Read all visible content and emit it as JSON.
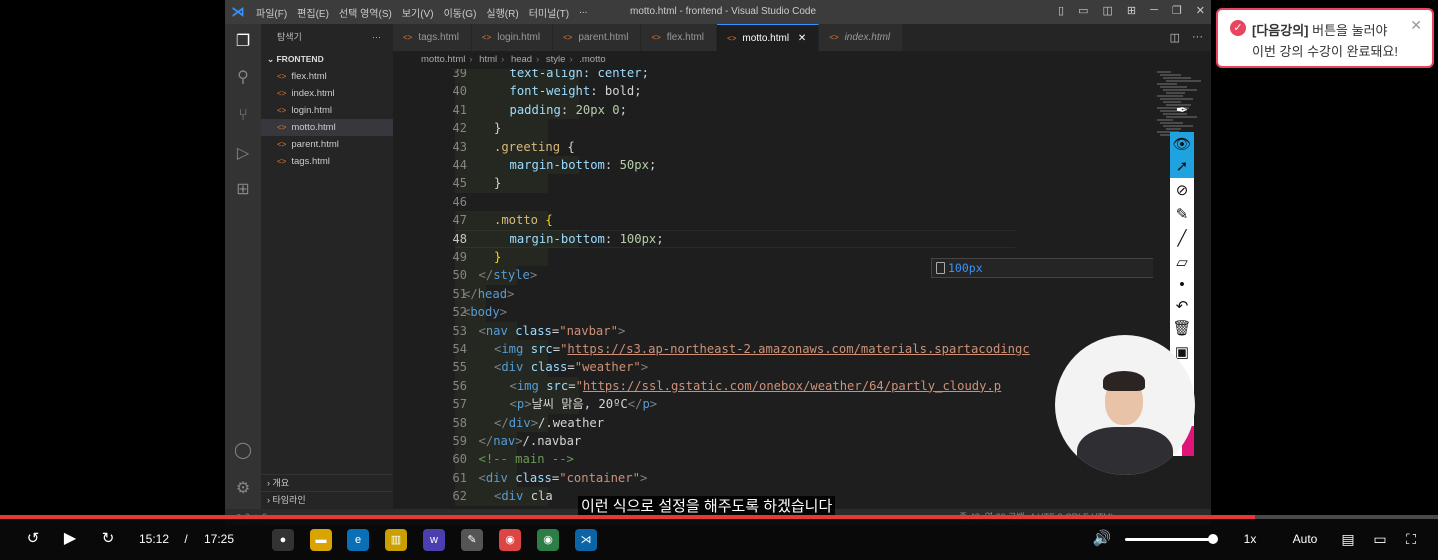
{
  "vscode": {
    "menu": [
      "파일(F)",
      "편집(E)",
      "선택 영역(S)",
      "보기(V)",
      "이동(G)",
      "실행(R)",
      "터미널(T)",
      "..."
    ],
    "window_title": "motto.html - frontend - Visual Studio Code",
    "explorer_title": "탐색기",
    "project": "FRONTEND",
    "files": [
      "flex.html",
      "index.html",
      "login.html",
      "motto.html",
      "parent.html",
      "tags.html"
    ],
    "selected_file": "motto.html",
    "outline_label": "개요",
    "timeline_label": "타임라인",
    "tabs": [
      {
        "label": "tags.html"
      },
      {
        "label": "login.html"
      },
      {
        "label": "parent.html"
      },
      {
        "label": "flex.html"
      },
      {
        "label": "motto.html",
        "active": true
      },
      {
        "label": "index.html",
        "italic": true
      }
    ],
    "breadcrumbs": [
      "motto.html",
      "html",
      "head",
      "style",
      ".motto"
    ],
    "suggestion": "100px",
    "status_left": "⊗ 0 △ 0",
    "status_right": "줄 48, 열 23   공백: 4   UTF-8   CRLF   HTML"
  },
  "code_lines": [
    {
      "n": "39",
      "indent": 4,
      "parts": [
        [
          "k-prop",
          "text-align: center;"
        ]
      ]
    },
    {
      "n": "40",
      "indent": 4,
      "parts": [
        [
          "k-prop",
          "font-weight"
        ],
        [
          "",
          ": "
        ],
        [
          "",
          "bold"
        ],
        [
          "",
          ";"
        ]
      ]
    },
    {
      "n": "41",
      "indent": 4,
      "parts": [
        [
          "k-prop",
          "padding"
        ],
        [
          "",
          ": "
        ],
        [
          "k-num",
          "20px 0"
        ],
        [
          "",
          ";"
        ]
      ]
    },
    {
      "n": "42",
      "indent": 3,
      "parts": [
        [
          "",
          "}"
        ]
      ]
    },
    {
      "n": "43",
      "indent": 3,
      "parts": [
        [
          "k-sel",
          ".greeting"
        ],
        [
          "",
          " {"
        ]
      ]
    },
    {
      "n": "44",
      "indent": 4,
      "parts": [
        [
          "k-prop",
          "margin-bottom"
        ],
        [
          "",
          ": "
        ],
        [
          "k-num",
          "50px"
        ],
        [
          "",
          ";"
        ]
      ]
    },
    {
      "n": "45",
      "indent": 3,
      "parts": [
        [
          "",
          "}"
        ]
      ]
    },
    {
      "n": "46",
      "indent": 0,
      "parts": []
    },
    {
      "n": "47",
      "indent": 3,
      "parts": [
        [
          "k-sel",
          ".motto"
        ],
        [
          "",
          " "
        ],
        [
          "k-bracket",
          "{"
        ]
      ]
    },
    {
      "n": "48",
      "indent": 4,
      "parts": [
        [
          "k-prop",
          "margin-bottom"
        ],
        [
          "",
          ": "
        ],
        [
          "k-num",
          "100px"
        ],
        [
          "",
          ";"
        ]
      ],
      "current": true
    },
    {
      "n": "49",
      "indent": 3,
      "parts": [
        [
          "k-bracket",
          "}"
        ]
      ]
    },
    {
      "n": "50",
      "indent": 2,
      "parts": [
        [
          "k-br",
          "</"
        ],
        [
          "k-tag",
          "style"
        ],
        [
          "k-br",
          ">"
        ]
      ]
    },
    {
      "n": "51",
      "indent": 1,
      "parts": [
        [
          "k-br",
          "</"
        ],
        [
          "k-tag",
          "head"
        ],
        [
          "k-br",
          ">"
        ]
      ]
    },
    {
      "n": "52",
      "indent": 1,
      "parts": [
        [
          "k-br",
          "<"
        ],
        [
          "k-tag",
          "body"
        ],
        [
          "k-br",
          ">"
        ]
      ]
    },
    {
      "n": "53",
      "indent": 2,
      "parts": [
        [
          "k-br",
          "<"
        ],
        [
          "k-tag",
          "nav"
        ],
        [
          "",
          " "
        ],
        [
          "k-attr",
          "class"
        ],
        [
          "",
          "="
        ],
        [
          "k-str",
          "\"navbar\""
        ],
        [
          "k-br",
          ">"
        ]
      ]
    },
    {
      "n": "54",
      "indent": 3,
      "parts": [
        [
          "k-br",
          "<"
        ],
        [
          "k-tag",
          "img"
        ],
        [
          "",
          " "
        ],
        [
          "k-attr",
          "src"
        ],
        [
          "",
          "="
        ],
        [
          "k-str",
          "\""
        ],
        [
          "k-url",
          "https://s3.ap-northeast-2.amazonaws.com/materials.spartacodingc"
        ]
      ]
    },
    {
      "n": "55",
      "indent": 3,
      "parts": [
        [
          "k-br",
          "<"
        ],
        [
          "k-tag",
          "div"
        ],
        [
          "",
          " "
        ],
        [
          "k-attr",
          "class"
        ],
        [
          "",
          "="
        ],
        [
          "k-str",
          "\"weather\""
        ],
        [
          "k-br",
          ">"
        ]
      ]
    },
    {
      "n": "56",
      "indent": 4,
      "parts": [
        [
          "k-br",
          "<"
        ],
        [
          "k-tag",
          "img"
        ],
        [
          "",
          " "
        ],
        [
          "k-attr",
          "src"
        ],
        [
          "",
          "="
        ],
        [
          "k-str",
          "\""
        ],
        [
          "k-url",
          "https://ssl.gstatic.com/onebox/weather/64/partly_cloudy.p"
        ]
      ]
    },
    {
      "n": "57",
      "indent": 4,
      "parts": [
        [
          "k-br",
          "<"
        ],
        [
          "k-tag",
          "p"
        ],
        [
          "k-br",
          ">"
        ],
        [
          "",
          "날씨 맑음, 20ºC"
        ],
        [
          "k-br",
          "</"
        ],
        [
          "k-tag",
          "p"
        ],
        [
          "k-br",
          ">"
        ]
      ]
    },
    {
      "n": "58",
      "indent": 3,
      "parts": [
        [
          "k-br",
          "</"
        ],
        [
          "k-tag",
          "div"
        ],
        [
          "k-br",
          ">"
        ],
        [
          "",
          "/.weather"
        ]
      ]
    },
    {
      "n": "59",
      "indent": 2,
      "parts": [
        [
          "k-br",
          "</"
        ],
        [
          "k-tag",
          "nav"
        ],
        [
          "k-br",
          ">"
        ],
        [
          "",
          "/.navbar"
        ]
      ]
    },
    {
      "n": "60",
      "indent": 2,
      "parts": [
        [
          "k-com",
          "<!-- main -->"
        ]
      ]
    },
    {
      "n": "61",
      "indent": 2,
      "parts": [
        [
          "k-br",
          "<"
        ],
        [
          "k-tag",
          "div"
        ],
        [
          "",
          " "
        ],
        [
          "k-attr",
          "class"
        ],
        [
          "",
          "="
        ],
        [
          "k-str",
          "\"container\""
        ],
        [
          "k-br",
          ">"
        ]
      ]
    },
    {
      "n": "62",
      "indent": 3,
      "parts": [
        [
          "k-br",
          "<"
        ],
        [
          "k-tag",
          "div"
        ],
        [
          "",
          " cla"
        ]
      ]
    }
  ],
  "toast": {
    "highlight": "[다음강의]",
    "line1_rest": " 버튼을 눌러야",
    "line2": "이번 강의 수강이 완료돼요!"
  },
  "subtitle": "이런 식으로 설정을 해주도록 하겠습니다",
  "player": {
    "current_time": "15:12",
    "separator": "/",
    "duration": "17:25",
    "progress": 0.873,
    "speed": "1x",
    "quality": "Auto",
    "volume": 1.0
  },
  "colors": {
    "accent_red": "#e53935",
    "toast_border": "#e94560",
    "vscode_bg": "#1e1e1e"
  }
}
